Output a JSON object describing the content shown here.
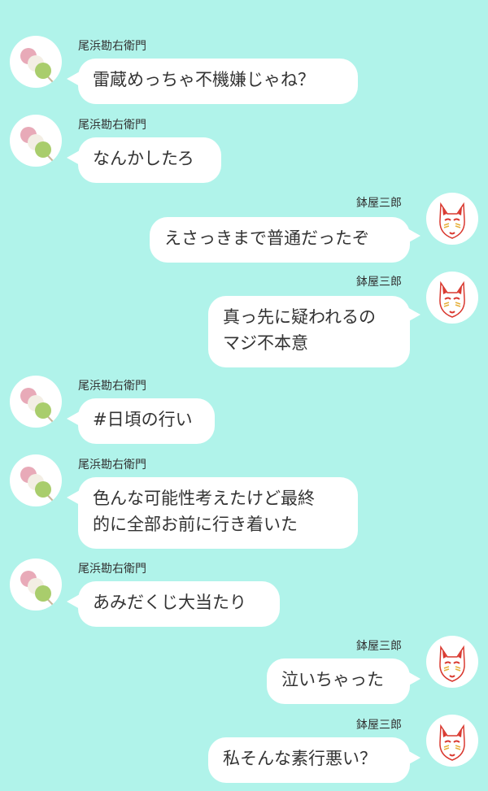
{
  "colors": {
    "background": "#b0f3ea",
    "bubble": "#ffffff",
    "text": "#333333",
    "dango_pink": "#e8aab8",
    "dango_white": "#f3eee4",
    "dango_green": "#a9cd6c",
    "mask_red": "#d9382f"
  },
  "users": {
    "left": {
      "name": "尾浜勘右衛門",
      "avatar_icon": "dango-icon"
    },
    "right": {
      "name": "鉢屋三郎",
      "avatar_icon": "fox-mask-icon"
    }
  },
  "messages": [
    {
      "side": "left",
      "name": "尾浜勘右衛門",
      "text": "雷蔵めっちゃ不機嫌じゃね？"
    },
    {
      "side": "left",
      "name": "尾浜勘右衛門",
      "text": "なんかしたろ"
    },
    {
      "side": "right",
      "name": "鉢屋三郎",
      "text": "えさっきまで普通だったぞ"
    },
    {
      "side": "right",
      "name": "鉢屋三郎",
      "text": "真っ先に疑われるの\nマジ不本意"
    },
    {
      "side": "left",
      "name": "尾浜勘右衛門",
      "text": "#日頃の行い"
    },
    {
      "side": "left",
      "name": "尾浜勘右衛門",
      "text": "色んな可能性考えたけど最終\n的に全部お前に行き着いた"
    },
    {
      "side": "left",
      "name": "尾浜勘右衛門",
      "text": "あみだくじ大当たり"
    },
    {
      "side": "right",
      "name": "鉢屋三郎",
      "text": "泣いちゃった"
    },
    {
      "side": "right",
      "name": "鉢屋三郎",
      "text": "私そんな素行悪い？"
    }
  ]
}
